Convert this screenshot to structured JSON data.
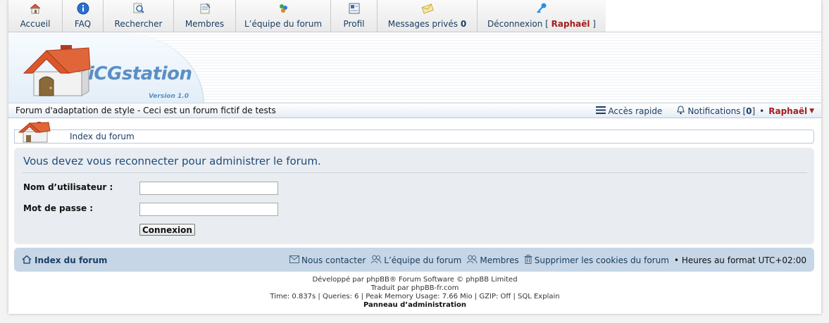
{
  "nav": {
    "items": [
      {
        "label": "Accueil",
        "icon": "home-icon"
      },
      {
        "label": "FAQ",
        "icon": "info-icon"
      },
      {
        "label": "Rechercher",
        "icon": "search-icon"
      },
      {
        "label": "Membres",
        "icon": "members-icon"
      },
      {
        "label": "L’équipe du forum",
        "icon": "team-icon"
      },
      {
        "label": "Profil",
        "icon": "profile-icon"
      }
    ],
    "pm_label": "Messages privés",
    "pm_count": "0",
    "logout_label": "Déconnexion",
    "logout_user": "Raphaël"
  },
  "banner": {
    "brand": "iCGstation",
    "version": "Version 1.0"
  },
  "subheader": {
    "description": "Forum d'adaptation de style - Ceci est un forum fictif de tests",
    "quick_access": "Accès rapide",
    "notifications_label": "Notifications",
    "notifications_count": "0",
    "user": "Raphaël"
  },
  "breadcrumb": {
    "label": "Index du forum"
  },
  "login": {
    "title": "Vous devez vous reconnecter pour administrer le forum.",
    "username_label": "Nom d’utilisateur :",
    "username_value": "",
    "password_label": "Mot de passe :",
    "password_value": "",
    "submit_label": "Connexion"
  },
  "footer_nav": {
    "home_label": "Index du forum",
    "contact": "Nous contacter",
    "team": "L’équipe du forum",
    "members": "Membres",
    "delete_cookies": "Supprimer les cookies du forum",
    "timezone": "Heures au format UTC+02:00"
  },
  "copyright": {
    "line1": "Développé par phpBB® Forum Software © phpBB Limited",
    "line2": "Traduit par phpBB-fr.com",
    "line3": "Time: 0.837s | Queries: 6 | Peak Memory Usage: 7.66 Mio | GZIP: Off | SQL Explain",
    "admin_link": "Panneau d’administration"
  },
  "colors": {
    "link": "#1b3e62",
    "username": "#a41d1d",
    "panel_bg": "#e9edf1",
    "footer_nav_bg": "#c6d6e6",
    "brand": "#5a8fc3"
  }
}
